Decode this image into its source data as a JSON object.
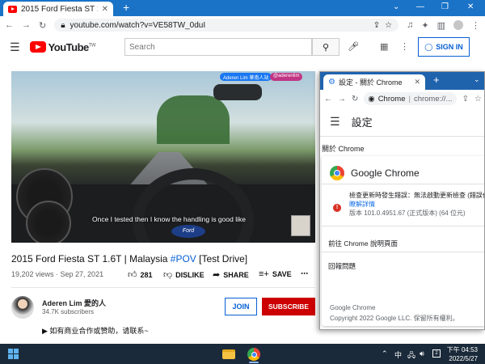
{
  "browser": {
    "tab_title": "2015 Ford Fiesta ST 1.6T | Ma",
    "url": "youtube.com/watch?v=VE58TW_0duI"
  },
  "youtube": {
    "logo_text": "YouTube",
    "logo_region": "TW",
    "search_placeholder": "Search",
    "signin_label": "SIGN IN"
  },
  "video": {
    "caption": "Once I tested then I know the handling is good like",
    "badge_facebook": "Aderen Lim 華南人站",
    "badge_instagram": "@aderenlim",
    "ford_logo": "Ford",
    "title_prefix": "2015 Ford Fiesta ST 1.6T | Malaysia ",
    "title_tag": "#POV",
    "title_suffix": " [Test Drive]",
    "views": "19,202 views · Sep 27, 2021",
    "like_count": "281",
    "dislike_label": "DISLIKE",
    "share_label": "SHARE",
    "save_label": "SAVE"
  },
  "channel": {
    "name": "Aderen Lim 愛的人",
    "subscribers": "34.7K subscribers",
    "join_label": "JOIN",
    "subscribe_label": "SUBSCRIBE",
    "description": "▶ 如有商业合作或赞助，请联系~"
  },
  "settings_window": {
    "tab_title": "設定 - 關於 Chrome",
    "omni_site": "Chrome",
    "omni_path": "chrome://...",
    "header_title": "設定",
    "section_label": "關於 Chrome",
    "product_name": "Google Chrome",
    "error_text": "檢查更新時發生錯誤：無法啟動更新檢查 (錯誤代碼",
    "error_link": "瞭解詳情",
    "version": "版本 101.0.4951.67 (正式版本) (64 位元)",
    "help_item": "前往 Chrome 說明頁面",
    "report_item": "回報問題",
    "footer_name": "Google Chrome",
    "footer_copyright": "Copyright 2022 Google LLC. 保留所有權利。"
  },
  "taskbar": {
    "time_period": "下午 04:53",
    "date": "2022/5/27",
    "notification_count": "2"
  }
}
